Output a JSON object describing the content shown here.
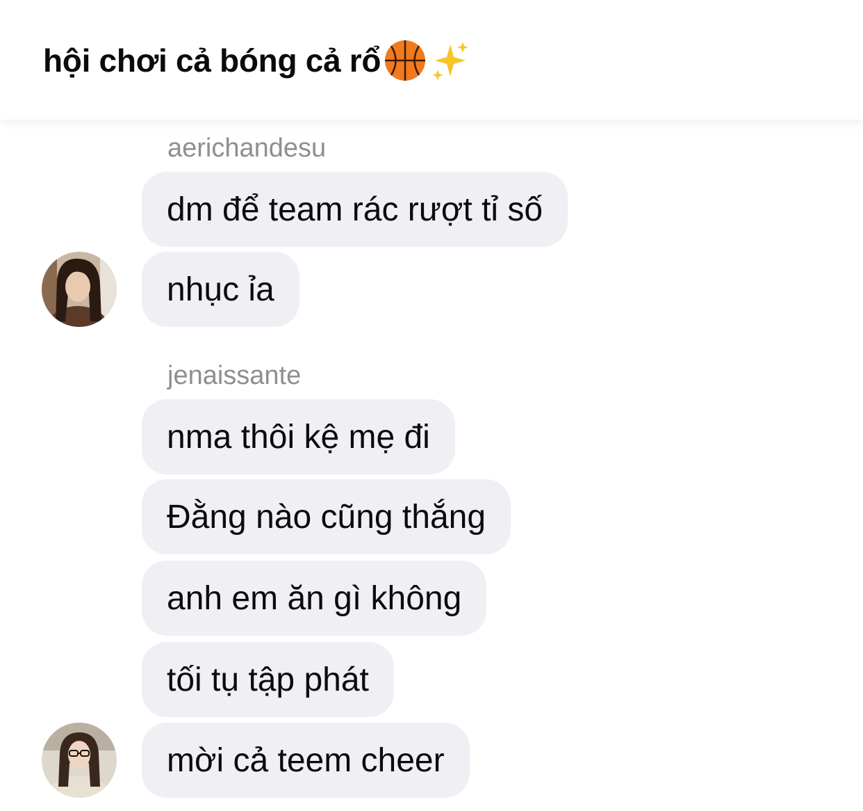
{
  "header": {
    "title": "hội chơi cả bóng cả rổ",
    "title_emojis": [
      "basketball-emoji",
      "sparkles-emoji"
    ]
  },
  "groups": [
    {
      "sender": "aerichandesu",
      "avatar": "avatar-aerichandesu",
      "messages": [
        "dm để team rác rượt tỉ số",
        "nhục ỉa"
      ]
    },
    {
      "sender": "jenaissante",
      "avatar": "avatar-jenaissante",
      "messages": [
        "nma thôi kệ mẹ đi",
        "Đằng nào cũng thắng",
        "anh em ăn gì không",
        "tối tụ tập phát",
        "mời cả teem cheer"
      ]
    }
  ],
  "colors": {
    "bubble": "#efeff4",
    "sender_name": "#8e8e93",
    "text": "#0b0b0b",
    "basketball": "#f07a1e"
  }
}
